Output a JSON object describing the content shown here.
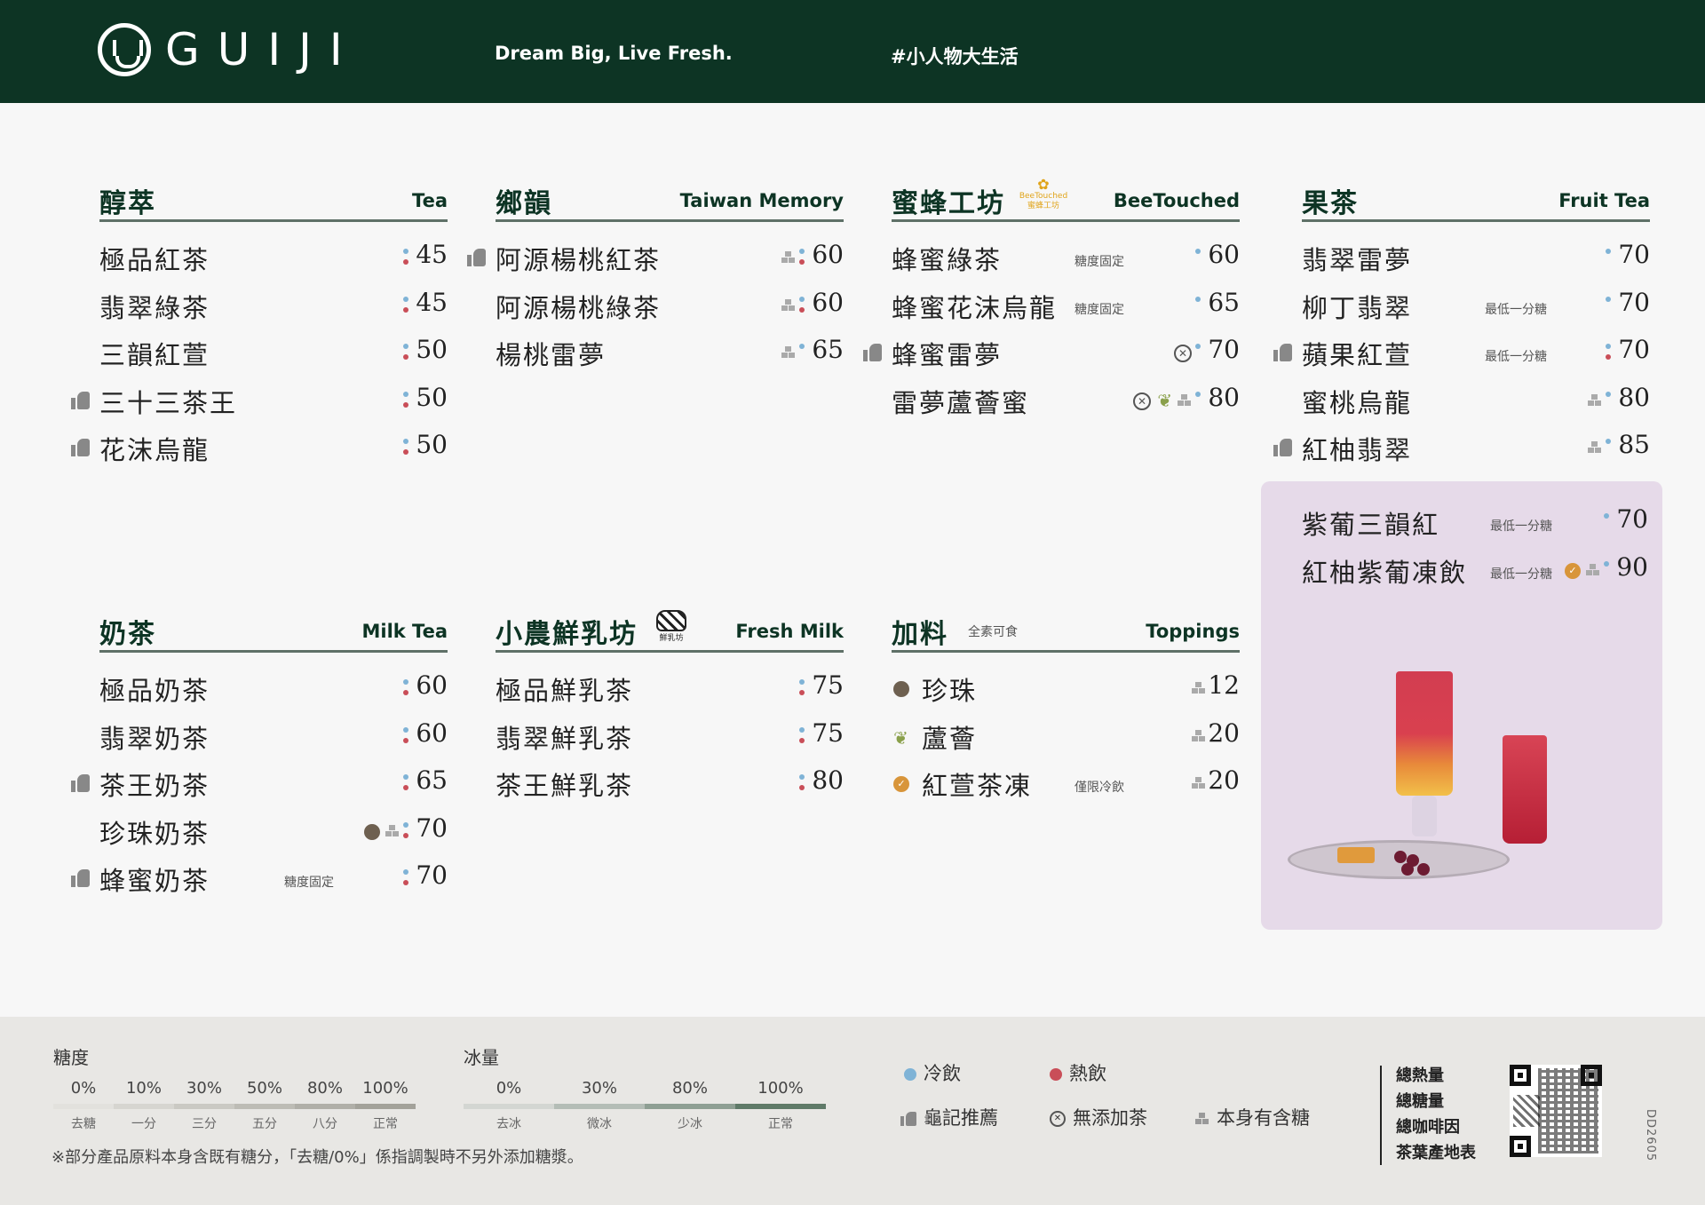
{
  "header": {
    "brand": "GUIJI",
    "slogan": "Dream Big, Live Fresh.",
    "hashtag": "#小人物大生活"
  },
  "tea": {
    "title_zh": "醇萃",
    "title_en": "Tea",
    "items": [
      {
        "name": "極品紅茶",
        "price": "45",
        "temp": "both"
      },
      {
        "name": "翡翠綠茶",
        "price": "45",
        "temp": "both"
      },
      {
        "name": "三韻紅萱",
        "price": "50",
        "temp": "both"
      },
      {
        "name": "三十三茶王",
        "price": "50",
        "temp": "both",
        "recommended": true
      },
      {
        "name": "花沫烏龍",
        "price": "50",
        "temp": "both",
        "recommended": true
      }
    ]
  },
  "taiwan": {
    "title_zh": "鄉韻",
    "title_en": "Taiwan Memory",
    "items": [
      {
        "name": "阿源楊桃紅茶",
        "price": "60",
        "temp": "both",
        "recommended": true,
        "sugar": true
      },
      {
        "name": "阿源楊桃綠茶",
        "price": "60",
        "temp": "both",
        "sugar": true
      },
      {
        "name": "楊桃雷夢",
        "price": "65",
        "temp": "cold",
        "sugar": true
      }
    ]
  },
  "bee": {
    "title_zh": "蜜蜂工坊",
    "title_en": "BeeTouched",
    "badge_en": "BeeTouched",
    "badge_zh": "蜜蜂工坊",
    "items": [
      {
        "name": "蜂蜜綠茶",
        "price": "60",
        "note": "糖度固定",
        "temp": "cold"
      },
      {
        "name": "蜂蜜花沫烏龍",
        "price": "65",
        "note": "糖度固定",
        "temp": "cold"
      },
      {
        "name": "蜂蜜雷夢",
        "price": "70",
        "temp": "cold",
        "recommended": true,
        "noadd": true
      },
      {
        "name": "雷夢蘆薈蜜",
        "price": "80",
        "temp": "cold",
        "noadd": true,
        "aloe": true,
        "sugar": true
      }
    ]
  },
  "fruit": {
    "title_zh": "果茶",
    "title_en": "Fruit Tea",
    "items": [
      {
        "name": "翡翠雷夢",
        "price": "70",
        "temp": "cold"
      },
      {
        "name": "柳丁翡翠",
        "price": "70",
        "note": "最低一分糖",
        "temp": "cold"
      },
      {
        "name": "蘋果紅萱",
        "price": "70",
        "note": "最低一分糖",
        "temp": "both",
        "recommended": true
      },
      {
        "name": "蜜桃烏龍",
        "price": "80",
        "temp": "cold",
        "sugar": true
      },
      {
        "name": "紅柚翡翠",
        "price": "85",
        "temp": "cold",
        "recommended": true,
        "sugar": true
      }
    ]
  },
  "promo": {
    "items": [
      {
        "name": "紫葡三韻紅",
        "price": "70",
        "note": "最低一分糖",
        "temp": "cold"
      },
      {
        "name": "紅柚紫葡凍飲",
        "price": "90",
        "note": "最低一分糖",
        "temp": "cold",
        "jelly": true,
        "sugar": true
      }
    ]
  },
  "milk_tea": {
    "title_zh": "奶茶",
    "title_en": "Milk Tea",
    "items": [
      {
        "name": "極品奶茶",
        "price": "60",
        "temp": "both"
      },
      {
        "name": "翡翠奶茶",
        "price": "60",
        "temp": "both"
      },
      {
        "name": "茶王奶茶",
        "price": "65",
        "temp": "both",
        "recommended": true
      },
      {
        "name": "珍珠奶茶",
        "price": "70",
        "temp": "both",
        "pearl": true,
        "sugar": true
      },
      {
        "name": "蜂蜜奶茶",
        "price": "70",
        "note": "糖度固定",
        "temp": "both",
        "recommended": true
      }
    ]
  },
  "fresh_milk": {
    "title_zh": "小農鮮乳坊",
    "title_en": "Fresh Milk",
    "badge_zh": "鮮乳坊",
    "items": [
      {
        "name": "極品鮮乳茶",
        "price": "75",
        "temp": "both"
      },
      {
        "name": "翡翠鮮乳茶",
        "price": "75",
        "temp": "both"
      },
      {
        "name": "茶王鮮乳茶",
        "price": "80",
        "temp": "both"
      }
    ]
  },
  "toppings": {
    "title_zh": "加料",
    "subtitle": "全素可食",
    "title_en": "Toppings",
    "items": [
      {
        "name": "珍珠",
        "price": "12",
        "icon": "pearl-icon",
        "sugar": true
      },
      {
        "name": "蘆薈",
        "price": "20",
        "icon": "aloe-icon",
        "sugar": true
      },
      {
        "name": "紅萱茶凍",
        "price": "20",
        "icon": "tea-jelly-icon",
        "note": "僅限冷飲",
        "sugar": true
      }
    ]
  },
  "footer": {
    "sugar_title": "糖度",
    "sugar_levels": [
      {
        "pct": "0%",
        "zh": "去糖"
      },
      {
        "pct": "10%",
        "zh": "一分"
      },
      {
        "pct": "30%",
        "zh": "三分"
      },
      {
        "pct": "50%",
        "zh": "五分"
      },
      {
        "pct": "80%",
        "zh": "八分"
      },
      {
        "pct": "100%",
        "zh": "正常"
      }
    ],
    "ice_title": "冰量",
    "ice_levels": [
      {
        "pct": "0%",
        "zh": "去冰"
      },
      {
        "pct": "30%",
        "zh": "微冰"
      },
      {
        "pct": "80%",
        "zh": "少冰"
      },
      {
        "pct": "100%",
        "zh": "正常"
      }
    ],
    "note": "※部分產品原料本身含既有糖分，「去糖/0%」係指調製時不另外添加糖漿。",
    "legend": {
      "cold": "冷飲",
      "hot": "熱飲",
      "recommended": "龜記推薦",
      "no_added_tea": "無添加茶",
      "contains_sugar": "本身有含糖"
    },
    "info_links": [
      "總熱量",
      "總糖量",
      "總咖啡因",
      "茶葉產地表"
    ],
    "code": "DD2605"
  },
  "colors": {
    "header_bg": "#0d3424",
    "cold": "#7fb3d6",
    "hot": "#c94e58",
    "promo_bg": "#e6dae9",
    "footer_bg": "#e8e7e4"
  }
}
